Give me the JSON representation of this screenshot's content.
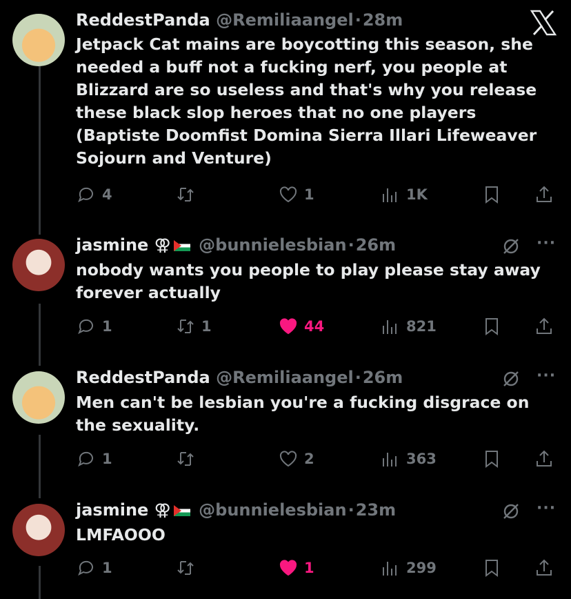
{
  "tweets": [
    {
      "display_name": "ReddestPanda",
      "handle": "@Remiliaangel",
      "time": "28m",
      "symbol": "",
      "text": "Jetpack Cat mains are boycotting this season, she needed a buff not a fucking nerf, you people at Blizzard are so useless and that's why you release these black slop heroes that no one players (Baptiste Doomfist Domina Sierra Illari Lifeweaver Sojourn and Venture)",
      "replies": "4",
      "reposts": "",
      "likes": "1",
      "views": "1K",
      "liked": false
    },
    {
      "display_name": "jasmine",
      "handle": "@bunnielesbian",
      "time": "26m",
      "symbol": "⚢",
      "text": "nobody wants you people to play please stay away forever actually",
      "replies": "1",
      "reposts": "1",
      "likes": "44",
      "views": "821",
      "liked": true
    },
    {
      "display_name": "ReddestPanda",
      "handle": "@Remiliaangel",
      "time": "26m",
      "symbol": "",
      "text": "Men can't be lesbian you're a fucking disgrace on the sexuality.",
      "replies": "1",
      "reposts": "",
      "likes": "2",
      "views": "363",
      "liked": false
    },
    {
      "display_name": "jasmine",
      "handle": "@bunnielesbian",
      "time": "23m",
      "symbol": "⚢",
      "text": "LMFAOOO",
      "replies": "1",
      "reposts": "",
      "likes": "1",
      "views": "299",
      "liked": true
    }
  ],
  "dot": "·",
  "more_label": "···",
  "colors": {
    "background": "#000000",
    "text": "#e7e9ea",
    "muted": "#71767b",
    "like": "#f91880"
  }
}
